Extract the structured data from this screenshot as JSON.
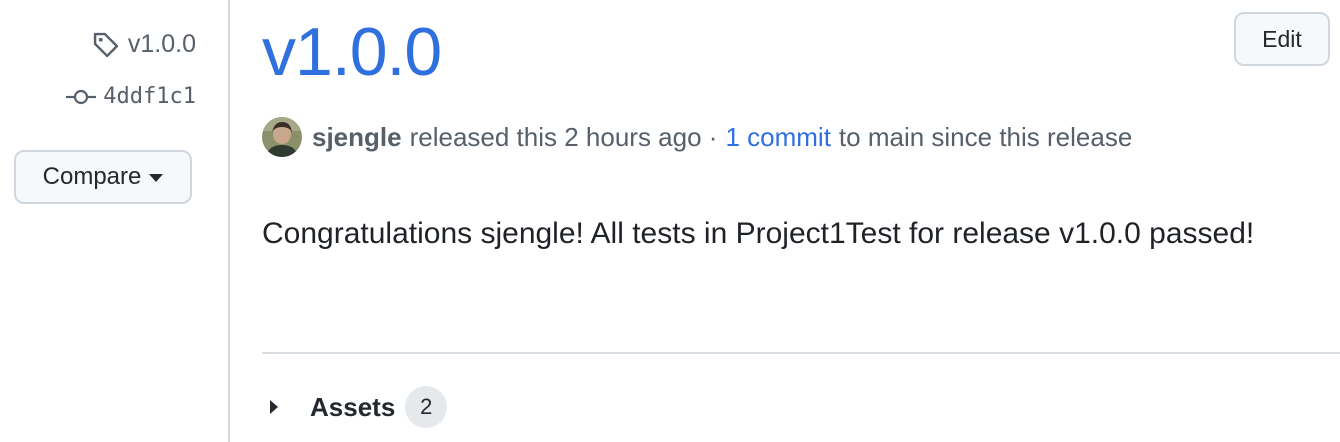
{
  "sidebar": {
    "tag_label": "v1.0.0",
    "tag_icon": "tag-icon",
    "commit_sha": "4ddf1c1",
    "commit_icon": "git-commit-icon",
    "compare_label": "Compare",
    "compare_icon": "triangle-down-icon"
  },
  "release": {
    "title": "v1.0.0",
    "edit_label": "Edit",
    "author": "sjengle",
    "released_text": "released this 2 hours ago ·",
    "commit_link": "1 commit",
    "since_text": "to main since this release",
    "body": "Congratulations sjengle! All tests in Project1Test for release v1.0.0 passed!"
  },
  "assets": {
    "label": "Assets",
    "count": "2",
    "icon": "triangle-right-icon"
  },
  "colors": {
    "link": "#2f6fde",
    "muted": "#57606a",
    "border": "#d0d7de",
    "button_bg": "#f6f8fa"
  }
}
